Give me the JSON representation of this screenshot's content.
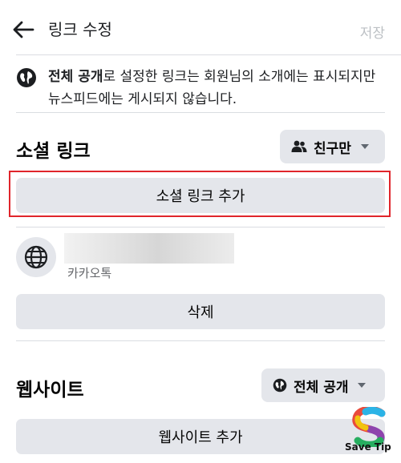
{
  "header": {
    "title": "링크 수정",
    "save_label": "저장"
  },
  "notice": {
    "audience": "전체 공개",
    "text_rest": "로 설정한 링크는 회원님의 소개에는 표시되지만 뉴스피드에는 게시되지 않습니다."
  },
  "social": {
    "title": "소셜 링크",
    "privacy_label": "친구만",
    "add_label": "소셜 링크 추가",
    "link_type": "카카오톡",
    "delete_label": "삭제"
  },
  "website": {
    "title": "웹사이트",
    "privacy_label": "전체 공개",
    "add_label": "웹사이트 추가"
  },
  "watermark": {
    "text": "Save Tip"
  },
  "colors": {
    "highlight": "#e0252b",
    "button_bg": "#e4e6eb",
    "disabled_text": "#bcc0c4"
  },
  "icons": [
    "back-arrow-icon",
    "globe-icon",
    "friends-icon",
    "caret-down-icon"
  ]
}
